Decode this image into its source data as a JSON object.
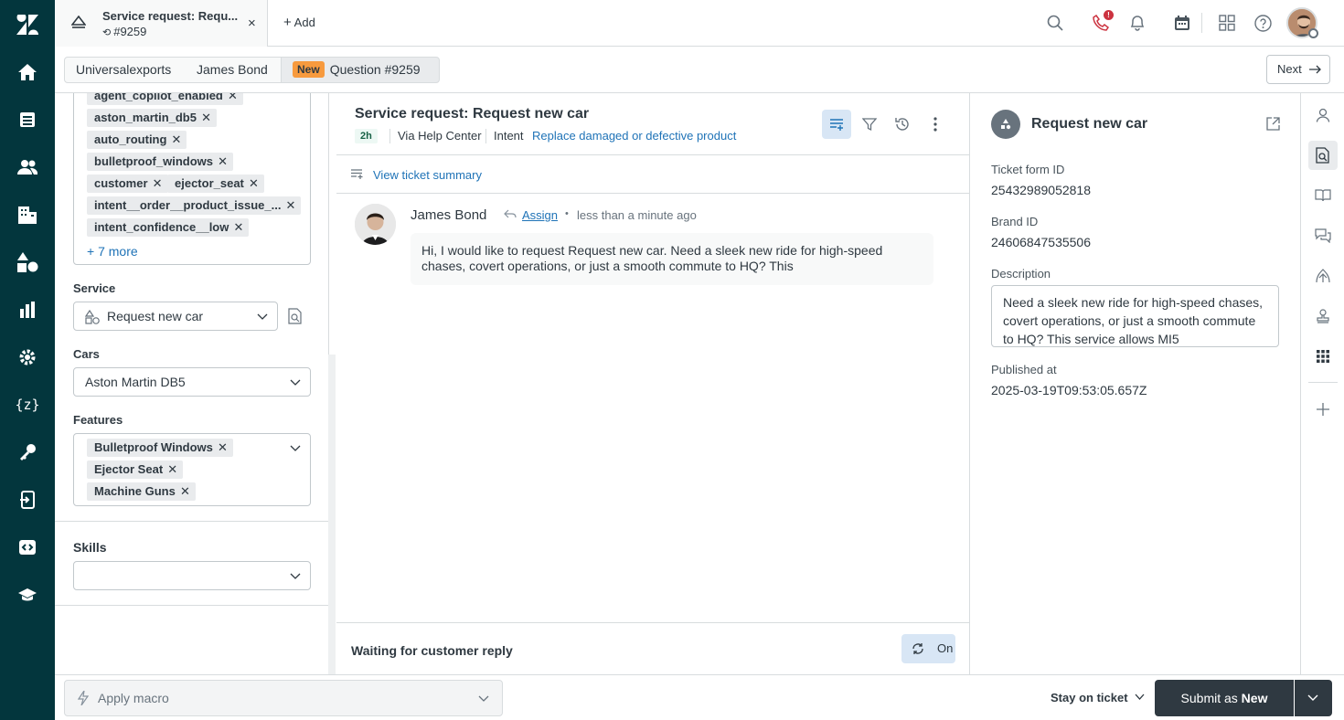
{
  "top": {
    "tab_title": "Service request: Requ...",
    "tab_sub": "#9259",
    "add_label": "Add",
    "phone_badge": "!"
  },
  "crumbs": {
    "org": "Universalexports",
    "user": "James Bond",
    "status": "New",
    "ticket": "Question #9259",
    "next": "Next"
  },
  "left": {
    "tags": [
      "agent_copilot_enabled",
      "aston_martin_db5",
      "auto_routing",
      "bulletproof_windows",
      "customer",
      "ejector_seat",
      "intent__order__product_issue_...",
      "intent_confidence__low"
    ],
    "more_tags": "+ 7 more",
    "service_label": "Service",
    "service_value": "Request new car",
    "cars_label": "Cars",
    "cars_value": "Aston Martin DB5",
    "features_label": "Features",
    "features": [
      "Bulletproof Windows",
      "Ejector Seat",
      "Machine Guns"
    ],
    "skills_label": "Skills",
    "skills_value": ""
  },
  "ticket": {
    "subject": "Service request: Request new car",
    "age": "2h",
    "channel": "Via Help Center",
    "intent_label": "Intent",
    "intent_value": "Replace damaged or defective product",
    "summary_link": "View ticket summary",
    "author": "James Bond",
    "assign": "Assign",
    "dot": "•",
    "time": "less than a minute ago",
    "message": "Hi, I would like to request Request new car. Need a sleek new ride for high-speed chases, covert operations, or just a smooth commute to HQ? This",
    "waiting": "Waiting for customer reply",
    "on_label": "On"
  },
  "context": {
    "title": "Request new car",
    "form_id_label": "Ticket form ID",
    "form_id": "25432989052818",
    "brand_id_label": "Brand ID",
    "brand_id": "24606847535506",
    "description_label": "Description",
    "description": "Need a sleek new ride for high-speed chases, covert operations, or just a smooth commute to HQ? This service allows MI5",
    "published_label": "Published at",
    "published": "2025-03-19T09:53:05.657Z"
  },
  "bottom": {
    "macro_placeholder": "Apply macro",
    "stay": "Stay on ticket",
    "submit_prefix": "Submit as",
    "submit_status": "New"
  },
  "colors": {
    "nav_bg": "#03363d",
    "accent_blue": "#1f73b7",
    "new_badge": "#f79a3e",
    "submit_bg": "#2f3941",
    "age_badge": "#edf8f4"
  }
}
